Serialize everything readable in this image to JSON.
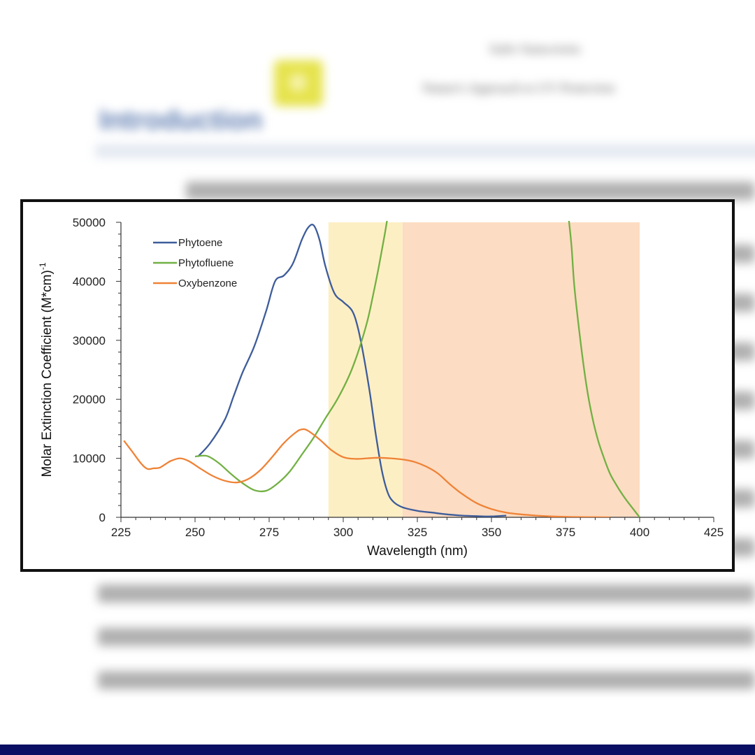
{
  "document": {
    "header_line_1": "Safer Sunscreens",
    "header_line_2": "Nature's Approach to UV Protection",
    "section_heading": "Introduction"
  },
  "colors": {
    "phytoene": "#3d5c9a",
    "phytofluene": "#72b043",
    "oxybenzone": "#ef8236",
    "uvb_band": "#fdefc4",
    "uva_band": "#fcdcc3",
    "bottom_bar": "#0b0f63"
  },
  "chart_data": {
    "type": "line",
    "xlabel": "Wavelength (nm)",
    "ylabel_main": "Molar Extinction Coefficient (M*cm)",
    "ylabel_superscript": "-1",
    "xlim": [
      225,
      425
    ],
    "ylim": [
      0,
      50000
    ],
    "x_ticks": [
      225,
      250,
      275,
      300,
      325,
      350,
      375,
      400,
      425
    ],
    "y_ticks": [
      0,
      10000,
      20000,
      30000,
      40000,
      50000
    ],
    "grid": false,
    "legend_position": "top-left",
    "shaded_bands": [
      {
        "x_start": 295,
        "x_end": 320,
        "color": "#fdefc4"
      },
      {
        "x_start": 320,
        "x_end": 400,
        "color": "#fcdcc3"
      }
    ],
    "series": [
      {
        "name": "Phytoene",
        "color": "#3d5c9a",
        "x": [
          251,
          255,
          260,
          263,
          266,
          270,
          274,
          277,
          280,
          283,
          286,
          288,
          290,
          292,
          294,
          297,
          300,
          303,
          305,
          307,
          309,
          311,
          313,
          315,
          317,
          320,
          325,
          330,
          335,
          340,
          345,
          350,
          355
        ],
        "y": [
          10300,
          12500,
          16500,
          20500,
          24500,
          29000,
          35000,
          40000,
          41000,
          43000,
          47000,
          49000,
          49500,
          47000,
          42500,
          38000,
          36500,
          35000,
          32000,
          27000,
          21000,
          14000,
          8000,
          4200,
          2600,
          1700,
          1100,
          800,
          500,
          300,
          200,
          150,
          300
        ]
      },
      {
        "name": "Phytofluene",
        "color": "#72b043",
        "x": [
          250,
          254,
          258,
          262,
          266,
          270,
          274,
          278,
          282,
          286,
          290,
          294,
          298,
          302,
          305,
          308,
          310,
          312,
          314,
          315,
          376,
          377,
          378,
          380,
          382,
          384,
          386,
          388,
          390,
          392,
          394,
          396,
          398,
          400
        ],
        "y": [
          10300,
          10400,
          9200,
          7400,
          5800,
          4600,
          4500,
          5800,
          7800,
          10600,
          13500,
          16800,
          20000,
          24000,
          28000,
          33000,
          37500,
          42500,
          48000,
          51000,
          51000,
          46000,
          39000,
          30000,
          22500,
          17000,
          13000,
          10000,
          7400,
          5600,
          4000,
          2600,
          1300,
          0
        ]
      },
      {
        "name": "Oxybenzone",
        "color": "#ef8236",
        "x": [
          226,
          229,
          232,
          234,
          236,
          238,
          240,
          242,
          245,
          248,
          252,
          256,
          260,
          264,
          268,
          272,
          276,
          280,
          284,
          286,
          288,
          292,
          296,
          300,
          304,
          308,
          312,
          316,
          320,
          324,
          328,
          332,
          336,
          340,
          345,
          350,
          355,
          360,
          365,
          370,
          375,
          380,
          385,
          390
        ],
        "y": [
          13000,
          11000,
          9000,
          8200,
          8300,
          8400,
          9000,
          9600,
          10000,
          9500,
          8200,
          7000,
          6200,
          5900,
          6500,
          8000,
          10200,
          12600,
          14400,
          14900,
          14700,
          13200,
          11400,
          10200,
          9900,
          10000,
          10100,
          10000,
          9800,
          9400,
          8600,
          7400,
          5600,
          4000,
          2400,
          1400,
          800,
          500,
          300,
          150,
          80,
          40,
          20,
          0
        ]
      }
    ]
  }
}
